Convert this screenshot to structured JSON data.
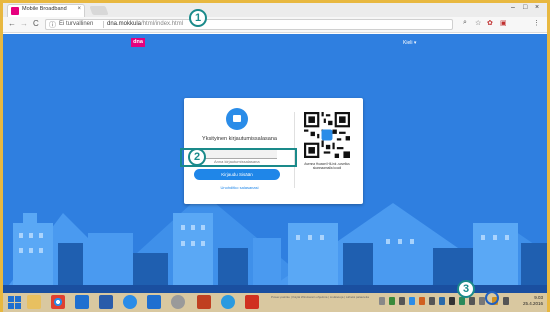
{
  "browser": {
    "tab_title": "Mobile Broadband",
    "tab_close": "×",
    "window_controls": [
      "–",
      "□",
      "×"
    ],
    "security_label": "Ei turvallinen",
    "url_host": "dna.mokkula",
    "url_path": "/html/index.html",
    "nav": {
      "back": "←",
      "forward": "→",
      "reload": "C"
    },
    "extensions": [
      "⌕",
      "☆",
      "✿",
      "▣",
      "⋮"
    ]
  },
  "page": {
    "logo": "dna",
    "language": "Kieli ▾"
  },
  "login_card": {
    "heading": "Yksityinen kirjautumissalasana",
    "password_placeholder": "Anna kirjautumissalasana",
    "login_button": "Kirjaudu Sisään",
    "forgot_link": "Unohditko salasanasi",
    "qr_caption": "Asenna Huawei HiLink -sovellus skannaamalla koodi"
  },
  "annotations": {
    "marker_1": "1",
    "marker_2": "2",
    "marker_3": "3"
  },
  "taskbar": {
    "center_text": "Power-painike  |  Käytä Windowsin ohjelmia  |  Lisätietoja  |  Lähetä palautetta",
    "clock_time": "9.03",
    "clock_date": "25.4.2016"
  },
  "colors": {
    "page_bg": "#2f7fe0",
    "brand": "#e6007e",
    "accent": "#1f86e8",
    "annotation": "#1a8a8a"
  }
}
